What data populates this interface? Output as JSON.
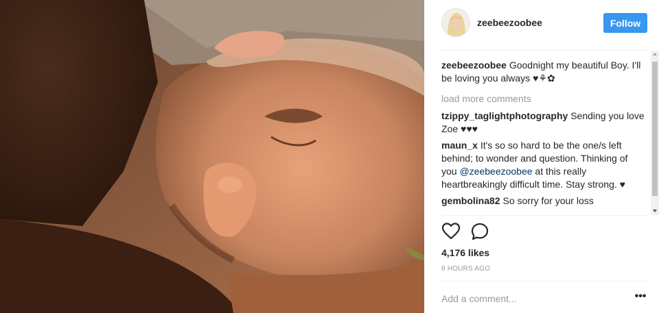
{
  "post": {
    "username": "zeebeezoobee",
    "follow_label": "Follow",
    "likes": "4,176 likes",
    "time": "8 HOURS AGO",
    "add_comment_placeholder": "Add a comment...",
    "more_label": "•••"
  },
  "comments": {
    "caption": {
      "user": "zeebeezoobee",
      "text": "Goodnight my beautiful Boy. I'll be loving you always ♥⚘✿"
    },
    "load_more": "load more comments",
    "items": [
      {
        "user": "tzippy_taglightphotography",
        "text": "Sending you love Zoe ♥♥♥"
      },
      {
        "user": "maun_x",
        "text_before": "It's so so hard to be the one/s left behind; to wonder and question. Thinking of you ",
        "mention": "@zeebeezoobee",
        "text_after": " at this really heartbreakingly difficult time. Stay strong. ♥"
      },
      {
        "user": "gembolina82",
        "text": "So sorry for your loss"
      }
    ]
  },
  "icons": {
    "like": "heart-outline-icon",
    "comment": "speech-bubble-icon"
  },
  "colors": {
    "follow_button": "#3897f0",
    "mention": "#003569",
    "muted": "#999999"
  }
}
